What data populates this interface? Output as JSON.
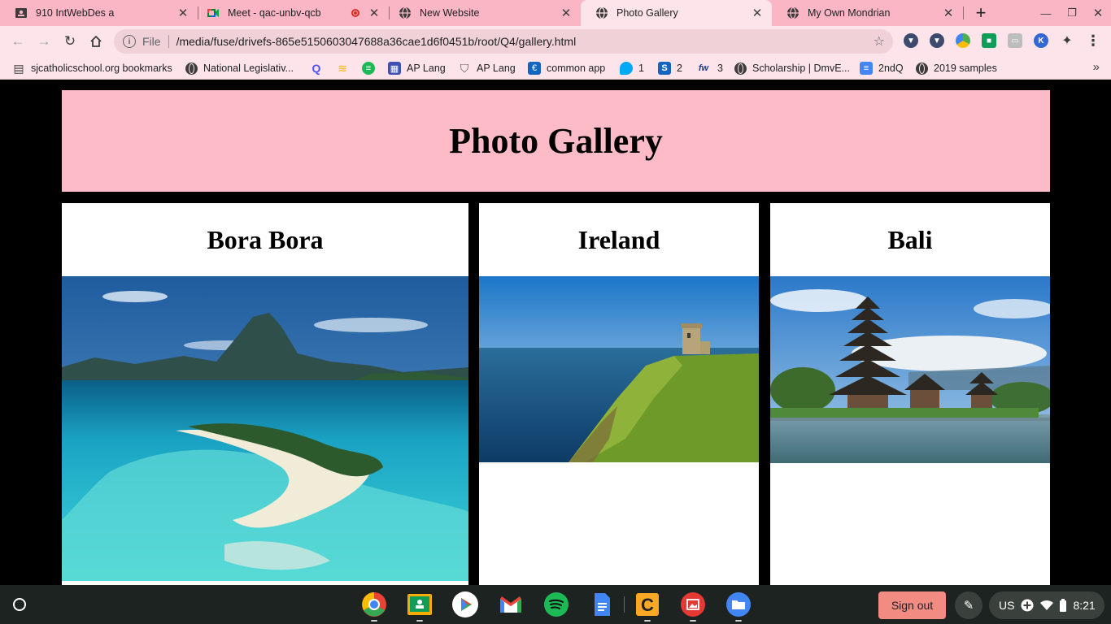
{
  "tabs": [
    {
      "title": "910 IntWebDes a",
      "icon": "classroom-icon"
    },
    {
      "title": "Meet - qac-unbv-qcb",
      "icon": "meet-icon",
      "recording": true
    },
    {
      "title": "New Website",
      "icon": "globe-icon"
    },
    {
      "title": "Photo Gallery",
      "icon": "globe-icon",
      "active": true
    },
    {
      "title": "My Own Mondrian",
      "icon": "globe-icon"
    }
  ],
  "omnibox": {
    "scheme": "File",
    "url": "/media/fuse/drivefs-865e5150603047688a36cae1d6f0451b/root/Q4/gallery.html"
  },
  "extensions": [
    {
      "icon": "shield-icon",
      "color": "#3c4a6e",
      "glyph": "▼"
    },
    {
      "icon": "shield-icon",
      "color": "#3c4a6e",
      "glyph": "▼"
    },
    {
      "icon": "drive-colored-icon",
      "color": "#4caf50",
      "glyph": "◆"
    },
    {
      "icon": "classroom-icon",
      "color": "#0f9d58",
      "glyph": "■"
    },
    {
      "icon": "screencast-icon",
      "color": "#9e9e9e",
      "glyph": "▭"
    },
    {
      "icon": "k-icon",
      "color": "#3367d6",
      "glyph": "K"
    },
    {
      "icon": "puzzle-icon",
      "color": "#3c3c3c",
      "glyph": "✦"
    },
    {
      "icon": "kebab-menu-icon",
      "color": "#3c3c3c",
      "glyph": "⋮"
    }
  ],
  "bookmarks": [
    {
      "label": "sjcatholicschool.org bookmarks",
      "icon": "folder-icon",
      "color": "#3c3c3c",
      "glyph": "▤"
    },
    {
      "label": "National Legislativ...",
      "icon": "globe-icon"
    },
    {
      "label": "",
      "icon": "q-icon",
      "color": "#4c52ff",
      "glyph": "Q"
    },
    {
      "label": "",
      "icon": "layers-icon",
      "color": "#ffb300",
      "glyph": "≋"
    },
    {
      "label": "",
      "icon": "spotify-icon",
      "color": "#1db954",
      "glyph": "≡"
    },
    {
      "label": "AP Lang",
      "icon": "calendar-icon",
      "color": "#3f51b5",
      "glyph": "▦"
    },
    {
      "label": "AP Lang",
      "icon": "shield-outline-icon",
      "color": "#555555",
      "glyph": "⛉"
    },
    {
      "label": "common app",
      "icon": "commonapp-icon",
      "color": "#1565c0",
      "glyph": "€"
    },
    {
      "label": "1",
      "icon": "chat-bubble-icon",
      "color": "#03a9f4",
      "glyph": "●"
    },
    {
      "label": "2",
      "icon": "s-icon",
      "color": "#1565c0",
      "glyph": "S"
    },
    {
      "label": "3",
      "icon": "fw-icon",
      "color": "#1e3a8a",
      "glyph": "fw"
    },
    {
      "label": "Scholarship | DmvE...",
      "icon": "globe-icon"
    },
    {
      "label": "2ndQ",
      "icon": "docs-icon",
      "color": "#4285f4",
      "glyph": "≡"
    },
    {
      "label": "2019 samples",
      "icon": "globe-icon"
    }
  ],
  "page": {
    "heading": "Photo Gallery",
    "cards": [
      {
        "title": "Bora Bora",
        "image": "bora-bora-lagoon-image"
      },
      {
        "title": "Ireland",
        "image": "ireland-cliffs-image"
      },
      {
        "title": "Bali",
        "image": "bali-temple-image"
      }
    ]
  },
  "shelf": {
    "apps": [
      {
        "name": "chrome-app",
        "color": "#4285f4",
        "running": true
      },
      {
        "name": "classroom-app",
        "color": "#0f9d58",
        "running": true
      },
      {
        "name": "play-store-app",
        "color": "#ffffff",
        "running": false
      },
      {
        "name": "gmail-app",
        "color": "#ea4335",
        "running": false
      },
      {
        "name": "spotify-app",
        "color": "#1db954",
        "running": false
      },
      {
        "name": "docs-app",
        "color": "#4285f4",
        "running": false
      },
      {
        "name": "c-app",
        "color": "#f9a825",
        "running": true
      },
      {
        "name": "gallery-app",
        "color": "#e53935",
        "running": true
      },
      {
        "name": "files-app",
        "color": "#4285f4",
        "running": true
      }
    ],
    "sign_out": "Sign out",
    "keyboard": "US",
    "time": "8:21"
  }
}
